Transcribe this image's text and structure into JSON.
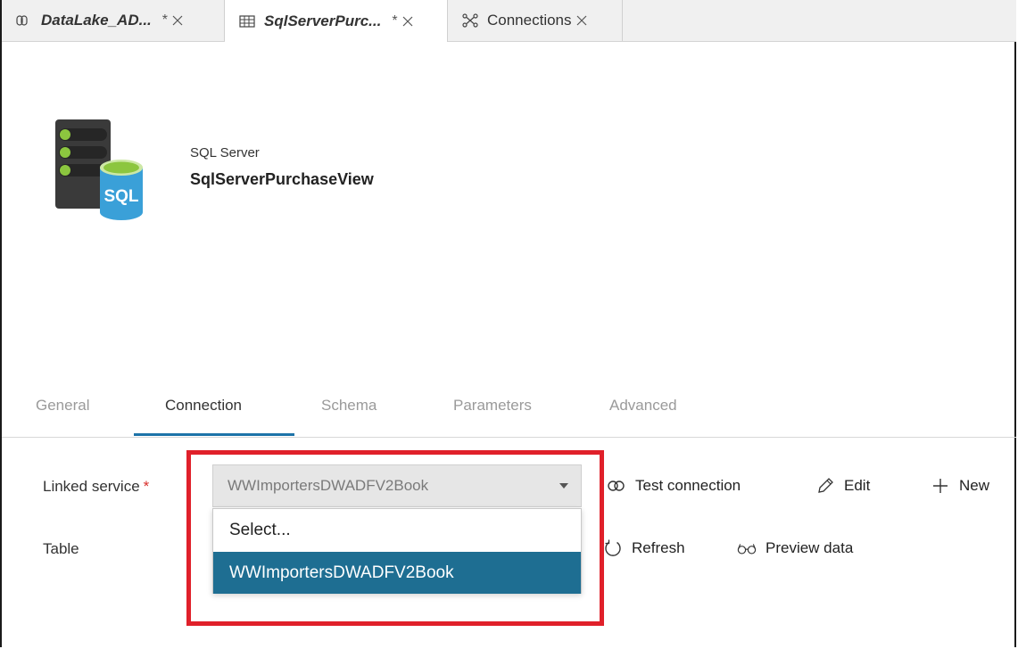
{
  "tabs": [
    {
      "label": "DataLake_AD...",
      "dirty": "*",
      "icon": "dataset-icon"
    },
    {
      "label": "SqlServerPurc...",
      "dirty": "*",
      "icon": "table-icon"
    },
    {
      "label": "Connections",
      "dirty": "",
      "icon": "connections-icon"
    }
  ],
  "dataset": {
    "type": "SQL Server",
    "name": "SqlServerPurchaseView",
    "icon_text": "SQL",
    "icon": "sql-server-icon"
  },
  "property_tabs": [
    {
      "label": "General",
      "active": false
    },
    {
      "label": "Connection",
      "active": true
    },
    {
      "label": "Schema",
      "active": false
    },
    {
      "label": "Parameters",
      "active": false
    },
    {
      "label": "Advanced",
      "active": false
    }
  ],
  "form": {
    "linked_service_label": "Linked service",
    "required_mark": "*",
    "linked_service_value": "WWImportersDWADFV2Book",
    "table_label": "Table"
  },
  "dropdown": {
    "options": [
      "Select...",
      "WWImportersDWADFV2Book"
    ],
    "selected": "WWImportersDWADFV2Book"
  },
  "actions": {
    "test_connection": "Test connection",
    "edit": "Edit",
    "new": "New",
    "refresh": "Refresh",
    "preview_data": "Preview data"
  },
  "colors": {
    "accent": "#1d73a8",
    "selected_option": "#1e6e92",
    "highlight": "#e0202a",
    "icon_green": "#8cc63f",
    "icon_blue": "#3aa0d8"
  }
}
